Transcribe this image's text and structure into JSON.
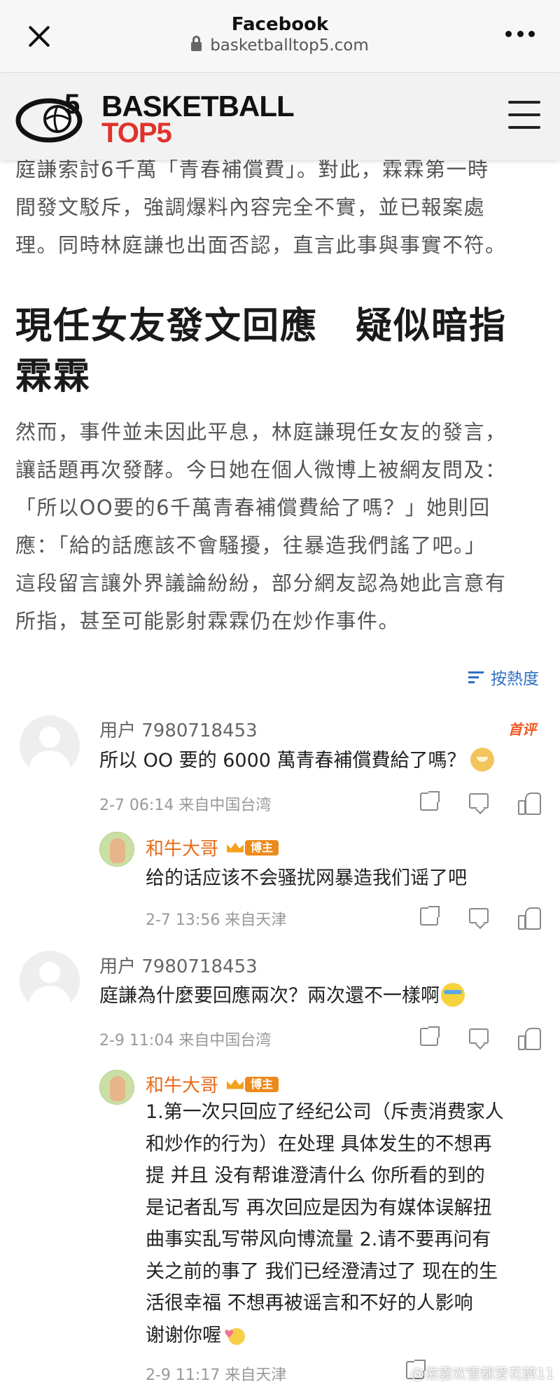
{
  "browser": {
    "title": "Facebook",
    "url": "basketballtop5.com",
    "close_icon": "close-icon",
    "more_icon": "more-horizontal-icon"
  },
  "site": {
    "logo_word1": "BASKETBALL",
    "logo_word2": "TOP5",
    "logo_mark": "T5",
    "brand_red": "#e0322b",
    "menu_icon": "hamburger-icon"
  },
  "article": {
    "para1_lines": [
      "庭謙索討6千萬「青春補償費」。對此，霖霖第一時",
      "間發文駁斥，強調爆料內容完全不實，並已報案處",
      "理。同時林庭謙也出面否認，直言此事與事實不符。"
    ],
    "heading_lines": [
      "現任女友發文回應　疑似暗指",
      "霖霖"
    ],
    "para2_lines": [
      "然而，事件並未因此平息，林庭謙現任女友的發言，",
      "讓話題再次發酵。今日她在個人微博上被網友問及：",
      "「所以OO要的6千萬青春補償費給了嗎？」她則回",
      "應：「給的話應該不會騷擾，往暴造我們謠了吧。」",
      "這段留言讓外界議論紛紛，部分網友認為她此言意有",
      "所指，甚至可能影射霖霖仍在炒作事件。"
    ]
  },
  "comments": {
    "sort_label": "按熱度",
    "sort_icon": "sort-icon",
    "hot_badge": "首评",
    "blogger_tag": "博主",
    "thread1": {
      "user": "用户 7980718453",
      "text": "所以 OO 要的 6000 萬青春補償費給了嗎？",
      "meta": "2-7 06:14  来自中国台湾",
      "reply": {
        "user": "和牛大哥",
        "text": "给的话应该不会骚扰网暴造我们谣了吧",
        "meta": "2-7 13:56  来自天津"
      }
    },
    "thread2": {
      "user": "用户 7980718453",
      "text": "庭謙為什麼要回應兩次？兩次還不一樣啊",
      "meta": "2-9 11:04  来自中国台湾",
      "reply": {
        "user": "和牛大哥",
        "lines": [
          "1.第一次只回应了经纪公司（斥责消费家人",
          "和炒作的行为）在处理 具体发生的不想再",
          "提 并且 没有帮谁澄清什么 你所看的到的",
          "是记者乱写 再次回应是因为有媒体误解扭",
          "曲事实乱写带风向博流量  2.请不要再问有",
          "关之前的事了 我们已经澄清过了 现在的生",
          "活很幸福 不想再被谣言和不好的人影响",
          "谢谢你喔"
        ],
        "meta": "2-9 11:17  来自天津"
      }
    }
  },
  "watermark": "@滋霎欢雪都爱花鹊11"
}
